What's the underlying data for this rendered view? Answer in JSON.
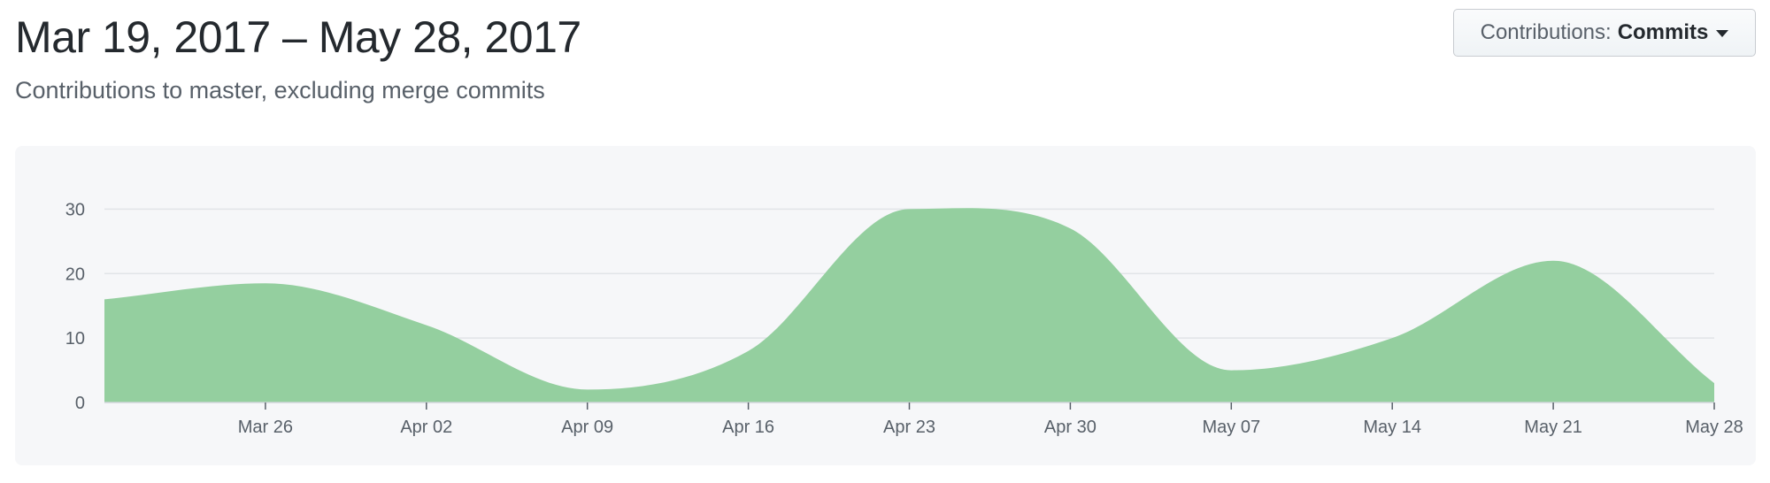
{
  "header": {
    "title": "Mar 19, 2017 – May 28, 2017",
    "subtitle": "Contributions to master, excluding merge commits"
  },
  "contributions_dropdown": {
    "label": "Contributions:",
    "value": "Commits",
    "icon": "caret-down-icon"
  },
  "chart_data": {
    "type": "area",
    "title": "",
    "xlabel": "",
    "ylabel": "",
    "color": "#94cf9f",
    "grid": true,
    "xlim": [
      "2017-03-19",
      "2017-05-28"
    ],
    "ylim": [
      0,
      35
    ],
    "y_ticks": [
      0,
      10,
      20,
      30
    ],
    "x_ticks": [
      {
        "date": "2017-03-26",
        "label": "Mar 26"
      },
      {
        "date": "2017-04-02",
        "label": "Apr 02"
      },
      {
        "date": "2017-04-09",
        "label": "Apr 09"
      },
      {
        "date": "2017-04-16",
        "label": "Apr 16"
      },
      {
        "date": "2017-04-23",
        "label": "Apr 23"
      },
      {
        "date": "2017-04-30",
        "label": "Apr 30"
      },
      {
        "date": "2017-05-07",
        "label": "May 07"
      },
      {
        "date": "2017-05-14",
        "label": "May 14"
      },
      {
        "date": "2017-05-21",
        "label": "May 21"
      },
      {
        "date": "2017-05-28",
        "label": "May 28"
      }
    ],
    "x": [
      "2017-03-19",
      "2017-03-26",
      "2017-04-02",
      "2017-04-09",
      "2017-04-16",
      "2017-04-23",
      "2017-04-30",
      "2017-05-07",
      "2017-05-14",
      "2017-05-21",
      "2017-05-28"
    ],
    "series": [
      {
        "values": [
          16,
          18.5,
          12,
          2,
          8,
          30,
          27,
          5,
          10,
          22,
          3
        ]
      }
    ]
  }
}
